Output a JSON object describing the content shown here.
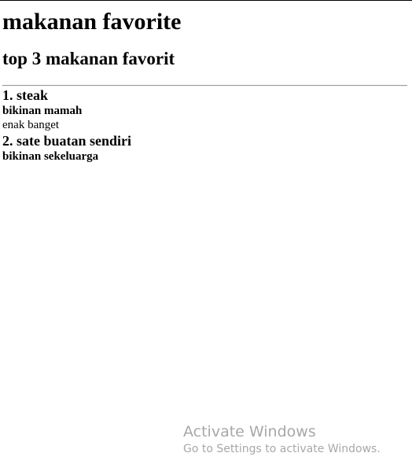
{
  "page": {
    "title": "makanan favorite",
    "subtitle": "top 3 makanan favorit"
  },
  "items": [
    {
      "title": "1. steak",
      "subtitle": "bikinan mamah",
      "description": "enak banget"
    },
    {
      "title": "2. sate buatan sendiri",
      "subtitle": "bikinan sekeluarga"
    }
  ],
  "watermark": {
    "title": "Activate Windows",
    "subtitle": "Go to Settings to activate Windows."
  }
}
